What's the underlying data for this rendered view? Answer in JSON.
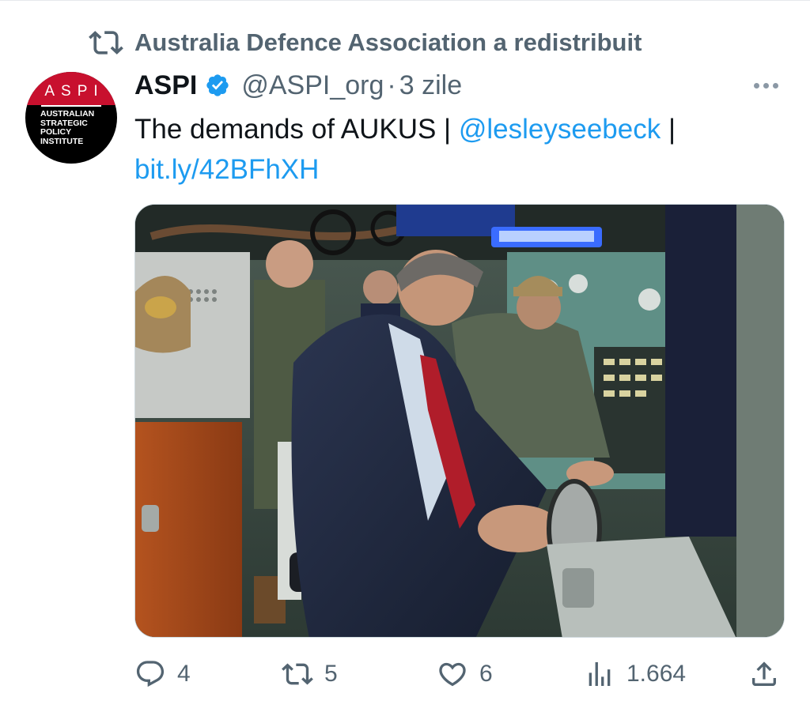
{
  "retweet_context": {
    "icon": "retweet-icon",
    "text": "Australia Defence Association a redistribuit"
  },
  "author": {
    "avatar_abbr": "ASPI",
    "avatar_lines": [
      "AUSTRALIAN",
      "STRATEGIC",
      "POLICY",
      "INSTITUTE"
    ],
    "display_name": "ASPI",
    "verified_icon": "verified-badge-icon",
    "handle": "@ASPI_org",
    "separator": "·",
    "time": "3 zile"
  },
  "tweet": {
    "text_main": "The demands of AUKUS | ",
    "mention": "@lesleyseebeck",
    "text_sep": " |",
    "link": "bit.ly/42BFhXH"
  },
  "media": {
    "description_icon": "photo"
  },
  "actions": {
    "replies": "4",
    "reposts": "5",
    "likes": "6",
    "views": "1.664"
  },
  "colors": {
    "link": "#1d9bf0",
    "secondary_text": "#536471",
    "primary_text": "#0f1419",
    "brand_red": "#c8102e"
  }
}
